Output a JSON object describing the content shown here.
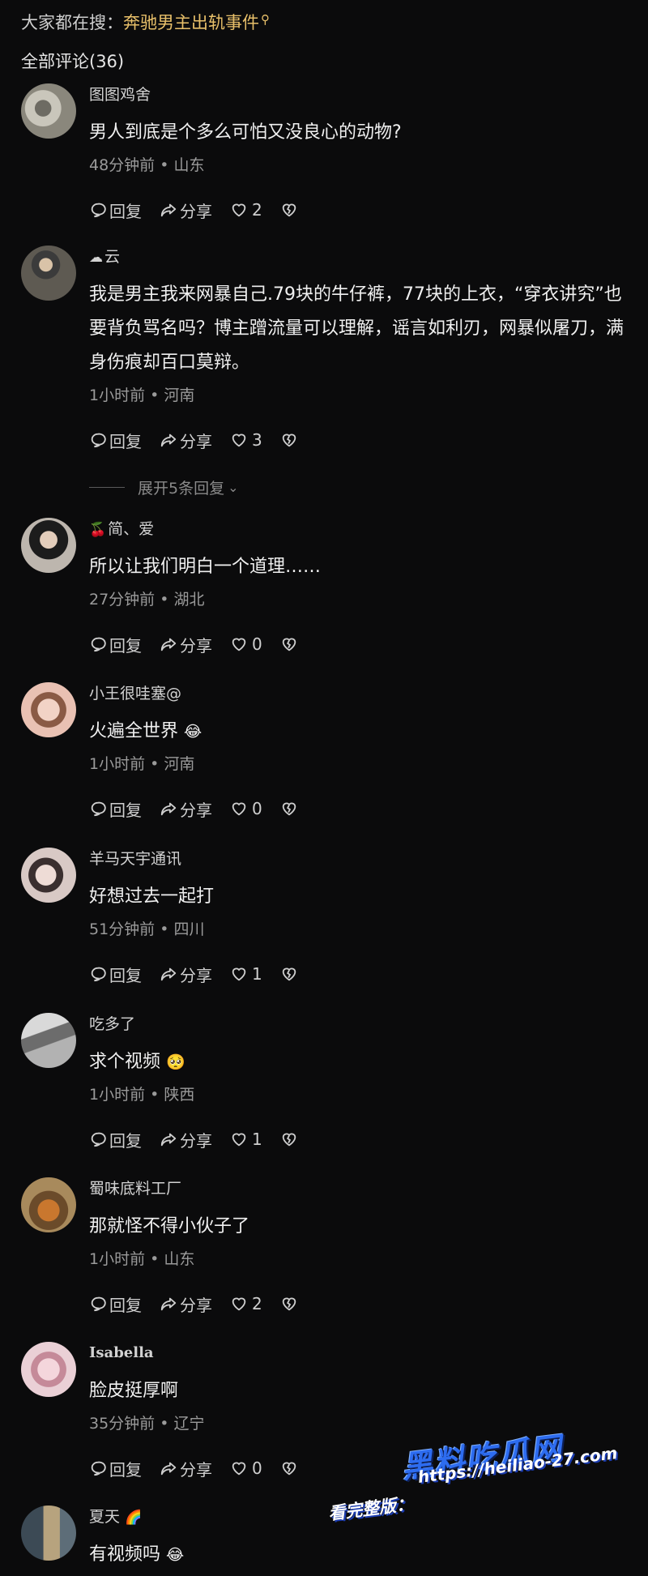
{
  "header": {
    "search_prefix": "大家都在搜：",
    "search_topic": "奔驰男主出轨事件",
    "all_comments": "全部评论(36)"
  },
  "actions": {
    "reply": "回复",
    "share": "分享"
  },
  "comments": [
    {
      "user": "图图鸡舍",
      "user_emoji": "",
      "text": "男人到底是个多么可怕又没良心的动物?",
      "text_emoji": "",
      "meta": "48分钟前 • 山东",
      "likes": "2"
    },
    {
      "user": "云",
      "user_emoji": "☁",
      "text": "我是男主我来网暴自己.79块的牛仔裤，77块的上衣，“穿衣讲究”也要背负骂名吗？博主蹭流量可以理解，谣言如利刃，网暴似屠刀，满身伤痕却百口莫辩。",
      "text_emoji": "",
      "meta": "1小时前 • 河南",
      "likes": "3"
    },
    {
      "user": "简、爱",
      "user_emoji": "🍒",
      "text": "所以让我们明白一个道理……",
      "text_emoji": "",
      "meta": "27分钟前 • 湖北",
      "likes": "0"
    },
    {
      "user": "小王很哇塞@",
      "user_emoji": "",
      "text": "火遍全世界",
      "text_emoji": "😂",
      "meta": "1小时前 • 河南",
      "likes": "0"
    },
    {
      "user": "羊马天宇通讯",
      "user_emoji": "",
      "text": "好想过去一起打",
      "text_emoji": "",
      "meta": "51分钟前 • 四川",
      "likes": "1"
    },
    {
      "user": "吃多了",
      "user_emoji": "",
      "text": "求个视频",
      "text_emoji": "🥺",
      "meta": "1小时前 • 陕西",
      "likes": "1"
    },
    {
      "user": "蜀味底料工厂",
      "user_emoji": "",
      "text": "那就怪不得小伙子了",
      "text_emoji": "",
      "meta": "1小时前 • 山东",
      "likes": "2"
    },
    {
      "user": "Isabella",
      "user_emoji": "",
      "text": "脸皮挺厚啊",
      "text_emoji": "",
      "meta": "35分钟前 • 辽宁",
      "likes": "0"
    },
    {
      "user": "夏天",
      "user_emoji": "🌈",
      "text": "有视频吗",
      "text_emoji": "😂",
      "meta": "",
      "likes": ""
    }
  ],
  "expand_replies": "展开5条回复",
  "watermark": {
    "logo": "黑料吃瓜网",
    "prefix": "看完整版：",
    "url": "https://heiliao-27.com"
  },
  "colors": {
    "background": "#0b0b0c",
    "topic": "#e8c06a",
    "watermark": "#2d6cf0"
  }
}
